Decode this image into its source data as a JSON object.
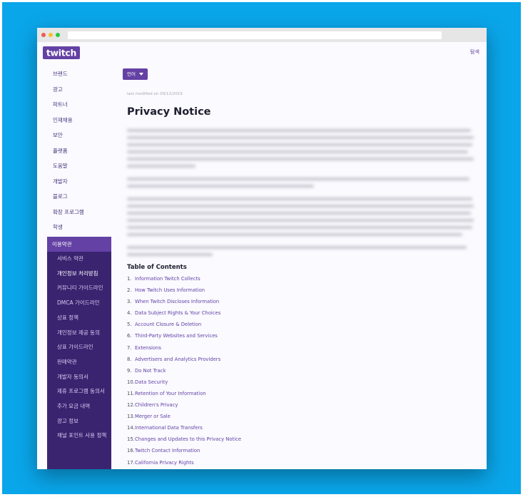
{
  "header": {
    "search_link": "탐색"
  },
  "nav": {
    "items": [
      "브랜드",
      "광고",
      "파트너",
      "인재채용",
      "보안",
      "플랫폼",
      "도움말",
      "개발자",
      "블로그",
      "확장 프로그램",
      "학생"
    ],
    "active": "이용약관",
    "sub_items": [
      "서비스 약관",
      "개인정보 처리방침",
      "커뮤니티 가이드라인",
      "DMCA 가이드라인",
      "상표 정책",
      "개인정보 제공 동의",
      "상표 가이드라인",
      "판매약관",
      "개발자 동의서",
      "제휴 프로그램 동의서",
      "추가 요금 내역",
      "광고 정보",
      "채널 포인트 사용 정책"
    ],
    "current_sub": "개인정보 처리방침"
  },
  "content": {
    "language_button": "언어",
    "last_modified": "last modified on 09/12/2019",
    "title": "Privacy Notice",
    "toc_title": "Table of Contents",
    "toc": [
      {
        "num": "1.",
        "label": "Information Twitch Collects"
      },
      {
        "num": "2.",
        "label": "How Twitch Uses Information"
      },
      {
        "num": "3.",
        "label": "When Twitch Discloses Information"
      },
      {
        "num": "4.",
        "label": "Data Subject Rights & Your Choices"
      },
      {
        "num": "5.",
        "label": "Account Closure & Deletion"
      },
      {
        "num": "6.",
        "label": "Third-Party Websites and Services"
      },
      {
        "num": "7.",
        "label": "Extensions"
      },
      {
        "num": "8.",
        "label": "Advertisers and Analytics Providers"
      },
      {
        "num": "9.",
        "label": "Do Not Track"
      },
      {
        "num": "10.",
        "label": "Data Security"
      },
      {
        "num": "11.",
        "label": "Retention of Your Information"
      },
      {
        "num": "12.",
        "label": "Children's Privacy"
      },
      {
        "num": "13.",
        "label": "Merger or Sale"
      },
      {
        "num": "14.",
        "label": "International Data Transfers"
      },
      {
        "num": "15.",
        "label": "Changes and Updates to this Privacy Notice"
      },
      {
        "num": "16.",
        "label": "Twitch Contact Information"
      },
      {
        "num": "17.",
        "label": "California Privacy Rights"
      }
    ]
  },
  "colors": {
    "accent": "#6441a4",
    "subnav_bg": "#3a2470",
    "background": "#0aa6ea"
  },
  "icons": [
    "twitch-logo",
    "caret-down-icon"
  ]
}
